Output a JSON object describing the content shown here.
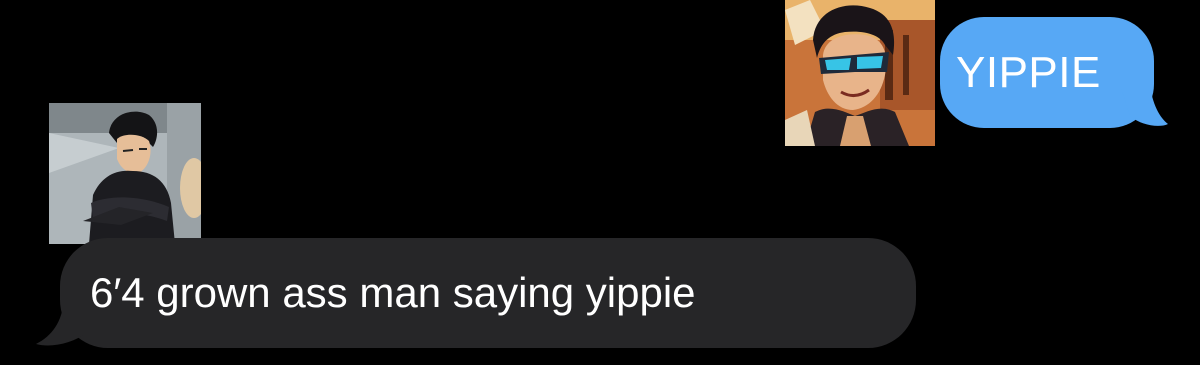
{
  "conversation": {
    "messages": [
      {
        "direction": "outgoing",
        "text": "YIPPIE",
        "bubble_color": "#57a8f5",
        "avatar_icon": "masked-hero-avatar-icon"
      },
      {
        "direction": "incoming",
        "text": "6′4 grown ass man saying yippie",
        "bubble_color": "#262628",
        "avatar_icon": "dark-haired-boy-avatar-icon"
      }
    ]
  },
  "colors": {
    "background": "#000000",
    "outgoing_bubble": "#57a8f5",
    "incoming_bubble": "#262628",
    "text": "#ffffff"
  }
}
